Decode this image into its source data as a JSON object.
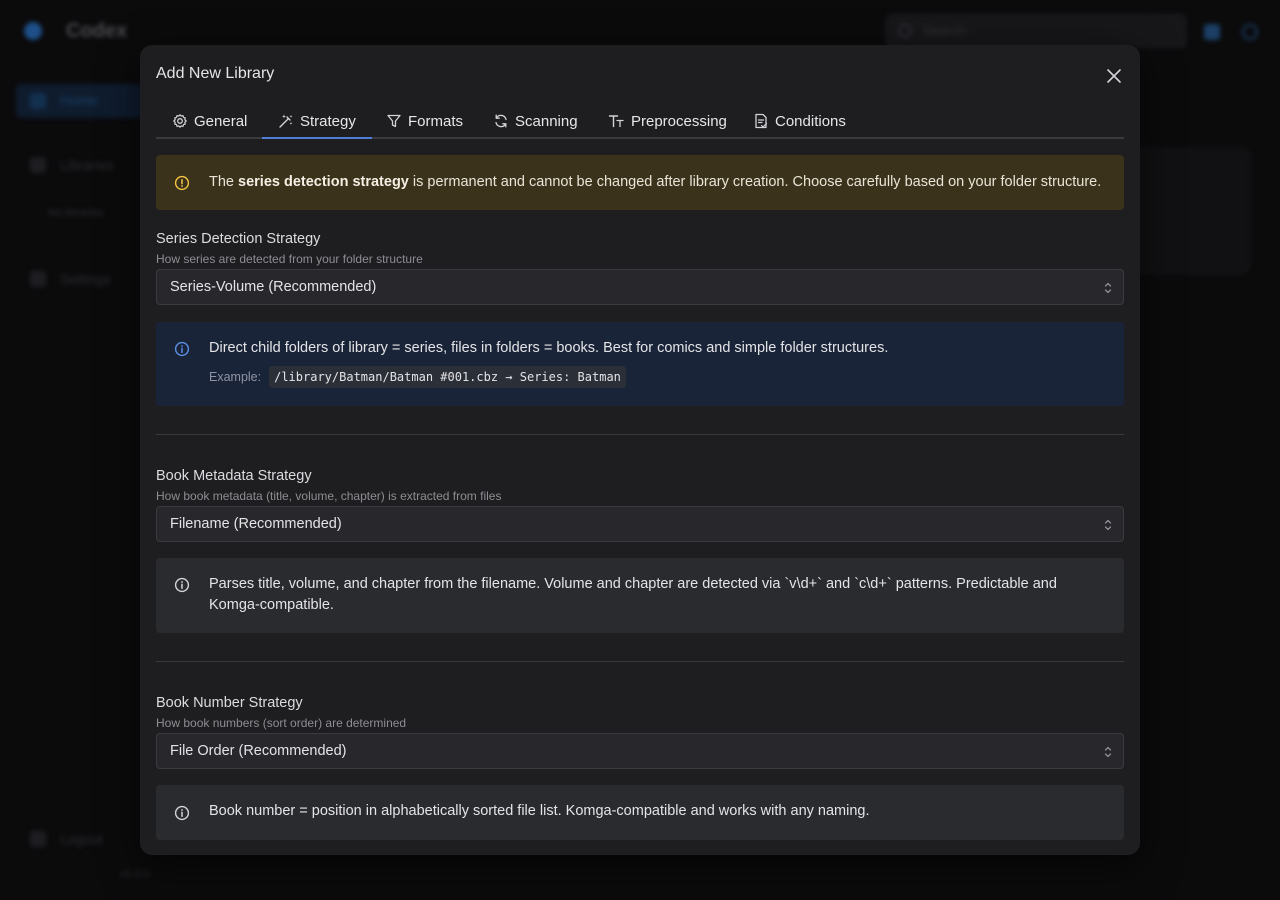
{
  "background": {
    "brand": "Codex",
    "search_placeholder": "Search",
    "nav": [
      {
        "label": "Home"
      },
      {
        "label": "Libraries"
      },
      {
        "label": "No libraries"
      },
      {
        "label": "Settings"
      },
      {
        "label": "Logout"
      }
    ],
    "version": "v1.0.0"
  },
  "modal": {
    "title": "Add New Library",
    "tabs": [
      {
        "label": "General",
        "icon": "gear-icon"
      },
      {
        "label": "Strategy",
        "icon": "wand-icon",
        "active": true
      },
      {
        "label": "Formats",
        "icon": "filter-icon"
      },
      {
        "label": "Scanning",
        "icon": "refresh-icon"
      },
      {
        "label": "Preprocessing",
        "icon": "text-size-icon"
      },
      {
        "label": "Conditions",
        "icon": "file-check-icon"
      }
    ],
    "warning": {
      "prefix": "The ",
      "bold": "series detection strategy",
      "suffix": " is permanent and cannot be changed after library creation. Choose carefully based on your folder structure."
    },
    "series": {
      "label": "Series Detection Strategy",
      "description": "How series are detected from your folder structure",
      "selected": "Series-Volume (Recommended)",
      "info": "Direct child folders of library = series, files in folders = books. Best for comics and simple folder structures.",
      "example_label": "Example:",
      "example_code": "/library/Batman/Batman #001.cbz → Series: Batman"
    },
    "book_metadata": {
      "label": "Book Metadata Strategy",
      "description": "How book metadata (title, volume, chapter) is extracted from files",
      "selected": "Filename (Recommended)",
      "info": "Parses title, volume, and chapter from the filename. Volume and chapter are detected via `v\\d+` and `c\\d+` patterns. Predictable and Komga-compatible."
    },
    "book_number": {
      "label": "Book Number Strategy",
      "description": "How book numbers (sort order) are determined",
      "selected": "File Order (Recommended)",
      "info": "Book number = position in alphabetically sorted file list. Komga-compatible and works with any naming."
    }
  },
  "colors": {
    "accent": "#4d7fd8",
    "warning_bg": "#3b321c",
    "warning_icon": "#f5c542",
    "info_blue_bg": "#1a2438"
  }
}
